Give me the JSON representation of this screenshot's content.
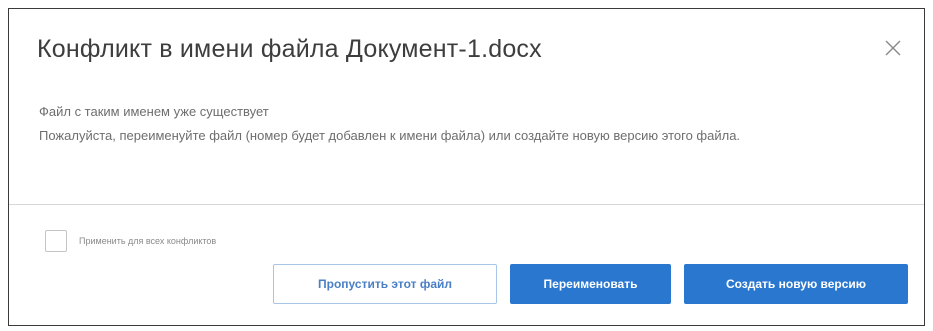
{
  "dialog": {
    "title": "Конфликт в имени файла Документ-1.docx",
    "close_icon": "close-icon",
    "message_line1": "Файл с таким именем уже существует",
    "message_line2": "Пожалуйста, переименуйте файл (номер будет добавлен к имени файла) или создайте новую версию этого файла.",
    "apply_all_label": "Применить для всех конфликтов",
    "apply_all_checked": false,
    "buttons": {
      "skip": "Пропустить этот файл",
      "rename": "Переименовать",
      "new_version": "Создать новую версию"
    },
    "colors": {
      "primary": "#2a77d0",
      "outline_text": "#4a7fc4",
      "outline_border": "#a8c4e6",
      "title": "#3d3d3d",
      "body_text": "#6e6e6e"
    }
  }
}
